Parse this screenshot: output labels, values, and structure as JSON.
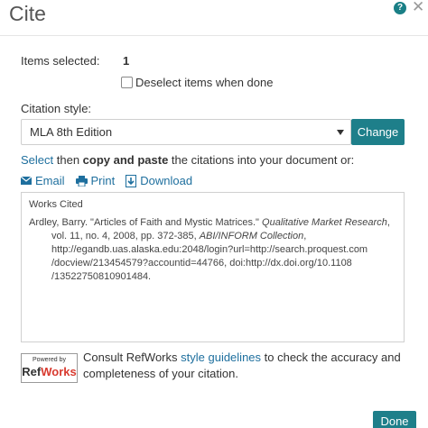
{
  "dialog": {
    "title": "Cite"
  },
  "items": {
    "label": "Items selected:",
    "count": "1"
  },
  "deselect": {
    "label": "Deselect items when done",
    "checked": false
  },
  "citation_style": {
    "label": "Citation style:",
    "selected": "MLA 8th Edition",
    "change_label": "Change"
  },
  "instruction": {
    "select_link": "Select",
    "then": " then ",
    "copy_paste": "copy and paste",
    "rest": " the citations into your document or:"
  },
  "actions": [
    {
      "label": "Email",
      "icon": "envelope-icon"
    },
    {
      "label": "Print",
      "icon": "printer-icon"
    },
    {
      "label": "Download",
      "icon": "download-icon"
    }
  ],
  "citation": {
    "heading": "Works Cited",
    "line1_pre": "Ardley, Barry. \"Articles of Faith and Mystic Matrices.\" ",
    "line1_journal": "Qualitative Market Research",
    "line1_post": ",",
    "line2_pre": "vol. 11, no. 4, 2008, pp. 372-385, ",
    "line2_collection": "ABI/INFORM Collection",
    "line2_post": ",",
    "line3": "http://egandb.uas.alaska.edu:2048/login?url=http://search.proquest.com",
    "line4": "/docview/213454579?accountid=44766, doi:http://dx.doi.org/10.1108",
    "line5": "/13522750810901484."
  },
  "refworks": {
    "powered_by": "Powered by",
    "brand_ref": "Ref",
    "brand_works": "Works",
    "text_pre": "Consult RefWorks ",
    "text_link": "style guidelines",
    "text_post": " to check the accuracy and completeness of your citation."
  },
  "footer": {
    "done_label": "Done"
  },
  "colors": {
    "accent": "#1e7f8a",
    "link": "#1e6f9e",
    "refworks_red": "#d83a2f"
  }
}
